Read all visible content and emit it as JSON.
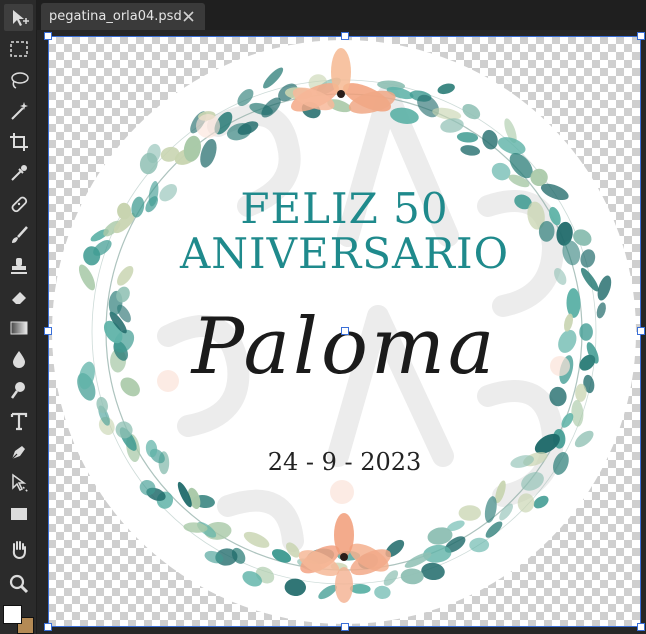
{
  "tab": {
    "filename": "pegatina_orla04.psd"
  },
  "tools": [
    {
      "name": "move-tool-icon"
    },
    {
      "name": "marquee-tool-icon"
    },
    {
      "name": "lasso-tool-icon"
    },
    {
      "name": "magic-wand-icon"
    },
    {
      "name": "crop-tool-icon"
    },
    {
      "name": "eyedropper-icon"
    },
    {
      "name": "healing-brush-icon"
    },
    {
      "name": "brush-tool-icon"
    },
    {
      "name": "clone-stamp-icon"
    },
    {
      "name": "eraser-icon"
    },
    {
      "name": "gradient-tool-icon"
    },
    {
      "name": "blur-tool-icon"
    },
    {
      "name": "dodge-tool-icon"
    },
    {
      "name": "type-tool-icon"
    },
    {
      "name": "pen-tool-icon"
    },
    {
      "name": "path-selection-icon"
    },
    {
      "name": "rectangle-tool-icon"
    },
    {
      "name": "hand-tool-icon"
    },
    {
      "name": "zoom-tool-icon"
    }
  ],
  "sticker": {
    "line1": "FELIZ 50",
    "line2": "ANIVERSARIO",
    "name": "Paloma",
    "date": "24 - 9 - 2023"
  },
  "colors": {
    "teal": "#1f8a8c",
    "foreground": "#ffffff",
    "background": "#b48a55"
  }
}
